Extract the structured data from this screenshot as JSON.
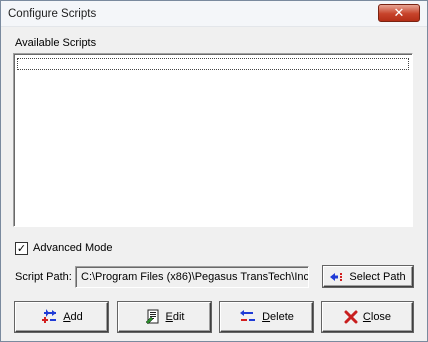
{
  "window": {
    "title": "Configure Scripts",
    "close_glyph": "✕"
  },
  "scripts": {
    "label": "Available Scripts",
    "items": []
  },
  "advanced_mode": {
    "label": "Advanced Mode",
    "checked": true,
    "check_glyph": "✓"
  },
  "script_path": {
    "label": "Script Path:",
    "value": "C:\\Program Files (x86)\\Pegasus TransTech\\Inc"
  },
  "buttons": {
    "select_path": {
      "label": "Select Path",
      "icon": "select-path-arrows-icon"
    },
    "add": {
      "label": "Add",
      "mnemonic": "A",
      "rest": "dd",
      "icon": "add-arrow-icon"
    },
    "edit": {
      "label": "Edit",
      "mnemonic": "E",
      "rest": "dit",
      "icon": "edit-document-icon"
    },
    "delete": {
      "label": "Delete",
      "mnemonic": "D",
      "rest": "elete",
      "icon": "delete-arrow-icon"
    },
    "close": {
      "label": "Close",
      "mnemonic": "C",
      "rest": "lose",
      "icon": "red-x-icon"
    }
  },
  "colors": {
    "accent_blue": "#1f3bd6",
    "accent_red": "#d21f1f",
    "title_close": "#c7432b"
  }
}
